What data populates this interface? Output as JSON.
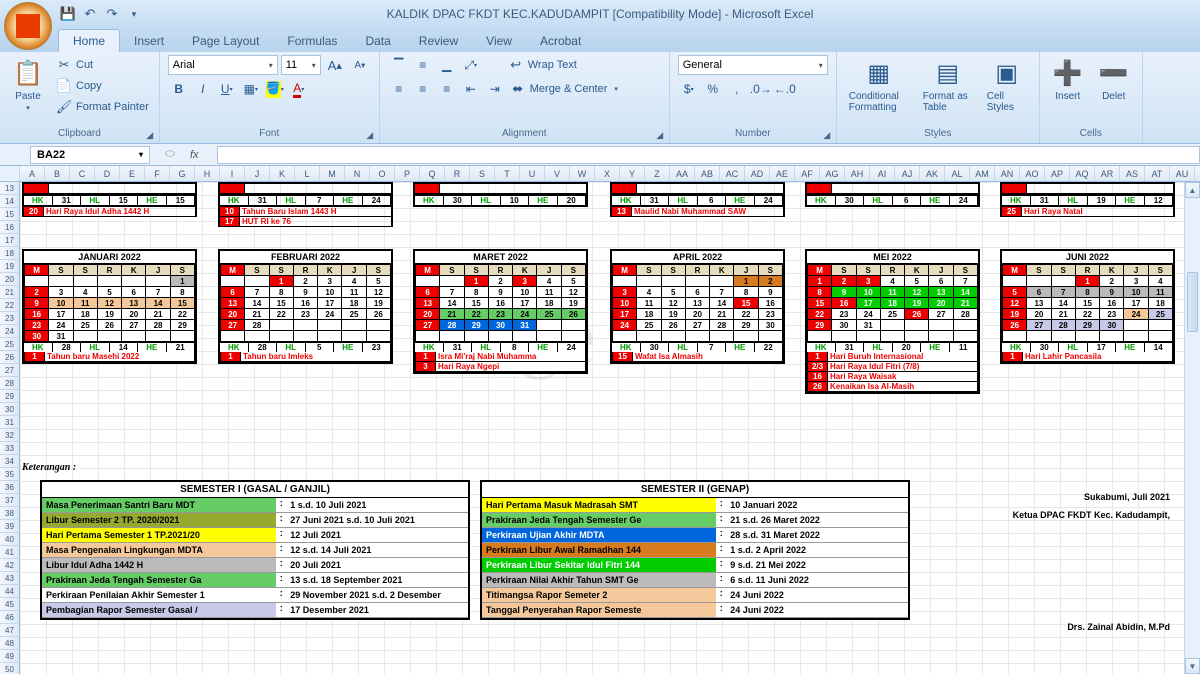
{
  "title": "KALDIK DPAC FKDT KEC.KADUDAMPIT  [Compatibility Mode] - Microsoft Excel",
  "namebox": "BA22",
  "tabs": [
    "Home",
    "Insert",
    "Page Layout",
    "Formulas",
    "Data",
    "Review",
    "View",
    "Acrobat"
  ],
  "clipboard": {
    "paste": "Paste",
    "cut": "Cut",
    "copy": "Copy",
    "fp": "Format Painter",
    "label": "Clipboard"
  },
  "font": {
    "name": "Arial",
    "size": "11",
    "label": "Font"
  },
  "alignment": {
    "wrap": "Wrap Text",
    "merge": "Merge & Center",
    "label": "Alignment"
  },
  "number": {
    "fmt": "General",
    "label": "Number"
  },
  "styles": {
    "cf": "Conditional Formatting",
    "ft": "Format as Table",
    "cs": "Cell Styles",
    "label": "Styles"
  },
  "cells": {
    "insert": "Insert",
    "delete": "Delet",
    "label": "Cells"
  },
  "cols": [
    "A",
    "B",
    "C",
    "D",
    "E",
    "F",
    "G",
    "H",
    "I",
    "J",
    "K",
    "L",
    "M",
    "N",
    "O",
    "P",
    "Q",
    "R",
    "S",
    "T",
    "U",
    "V",
    "W",
    "X",
    "Y",
    "Z",
    "AA",
    "AB",
    "AC",
    "AD",
    "AE",
    "AF",
    "AG",
    "AH",
    "AI",
    "AJ",
    "AK",
    "AL",
    "AM",
    "AN",
    "AO",
    "AP",
    "AQ",
    "AR",
    "AS",
    "AT",
    "AU"
  ],
  "rows_start": 13,
  "watermark": "Page 1",
  "ket": "Keterangan :",
  "hk_top": [
    [
      "HK",
      "31",
      "HL",
      "15",
      "HE",
      "15"
    ],
    [
      "HK",
      "31",
      "HL",
      "7",
      "HE",
      "24"
    ],
    [
      "HK",
      "30",
      "HL",
      "10",
      "HE",
      "20"
    ],
    [
      "HK",
      "31",
      "HL",
      "6",
      "HE",
      "24"
    ],
    [
      "HK",
      "30",
      "HL",
      "6",
      "HE",
      "24"
    ],
    [
      "HK",
      "31",
      "HL",
      "19",
      "HE",
      "12"
    ]
  ],
  "ev_top": [
    [
      {
        "d": "20",
        "t": "Hari Raya Idul Adha 1442 H"
      }
    ],
    [
      {
        "d": "10",
        "t": "Tahun Baru Islam 1443 H"
      },
      {
        "d": "17",
        "t": "HUT RI ke 76"
      }
    ],
    [],
    [
      {
        "d": "13",
        "t": "Maulid Nabi Muhammad SAW"
      }
    ],
    [],
    [
      {
        "d": "25",
        "t": "Hari Raya Natal"
      }
    ]
  ],
  "cals": [
    {
      "title": "JANUARI 2022",
      "hk": [
        "HK",
        "28",
        "HL",
        "14",
        "HE",
        "21"
      ],
      "ev": [
        {
          "d": "1",
          "t": "Tahun baru Masehi 2022"
        }
      ],
      "grid": [
        [
          "",
          "",
          "",
          "",
          "",
          "",
          "1"
        ],
        [
          "2",
          "3",
          "4",
          "5",
          "6",
          "7",
          "8"
        ],
        [
          "9",
          "10",
          "11",
          "12",
          "13",
          "14",
          "15"
        ],
        [
          "16",
          "17",
          "18",
          "19",
          "20",
          "21",
          "22"
        ],
        [
          "23",
          "24",
          "25",
          "26",
          "27",
          "28",
          "29"
        ],
        [
          "30",
          "31",
          "",
          "",
          "",
          "",
          ""
        ]
      ],
      "cls": [
        [
          "",
          "",
          "",
          "",
          "",
          "",
          "gray"
        ],
        [
          "red",
          "",
          "",
          "",
          "",
          "",
          ""
        ],
        [
          "red",
          "peach",
          "peach",
          "peach",
          "peach",
          "peach",
          "peach"
        ],
        [
          "red",
          "",
          "",
          "",
          "",
          "",
          ""
        ],
        [
          "red",
          "",
          "",
          "",
          "",
          "",
          ""
        ],
        [
          "red",
          "",
          "",
          "",
          "",
          "",
          ""
        ]
      ]
    },
    {
      "title": "FEBRUARI 2022",
      "hk": [
        "HK",
        "28",
        "HL",
        "5",
        "HE",
        "23"
      ],
      "ev": [
        {
          "d": "1",
          "t": "Tahun baru Imleks"
        }
      ],
      "grid": [
        [
          "",
          "",
          "1",
          "2",
          "3",
          "4",
          "5"
        ],
        [
          "6",
          "7",
          "8",
          "9",
          "10",
          "11",
          "12"
        ],
        [
          "13",
          "14",
          "15",
          "16",
          "17",
          "18",
          "19"
        ],
        [
          "20",
          "21",
          "22",
          "23",
          "24",
          "25",
          "26"
        ],
        [
          "27",
          "28",
          "",
          "",
          "",
          "",
          ""
        ],
        [
          "",
          "",
          "",
          "",
          "",
          "",
          ""
        ]
      ],
      "cls": [
        [
          "",
          "",
          "red",
          "",
          "",
          "",
          ""
        ],
        [
          "red",
          "",
          "",
          "",
          "",
          "",
          ""
        ],
        [
          "red",
          "",
          "",
          "",
          "",
          "",
          ""
        ],
        [
          "red",
          "",
          "",
          "",
          "",
          "",
          ""
        ],
        [
          "red",
          "",
          "",
          "",
          "",
          "",
          ""
        ],
        [
          "",
          "",
          "",
          "",
          "",
          "",
          ""
        ]
      ]
    },
    {
      "title": "MARET 2022",
      "hk": [
        "HK",
        "31",
        "HL",
        "8",
        "HE",
        "24"
      ],
      "ev": [
        {
          "d": "1",
          "t": "Isra Mi'raj Nabi Muhamma"
        },
        {
          "d": "3",
          "t": "Hari Raya Ngepi"
        }
      ],
      "grid": [
        [
          "",
          "",
          "1",
          "2",
          "3",
          "4",
          "5"
        ],
        [
          "6",
          "7",
          "8",
          "9",
          "10",
          "11",
          "12"
        ],
        [
          "13",
          "14",
          "15",
          "16",
          "17",
          "18",
          "19"
        ],
        [
          "20",
          "21",
          "22",
          "23",
          "24",
          "25",
          "26"
        ],
        [
          "27",
          "28",
          "29",
          "30",
          "31",
          "",
          ""
        ],
        [
          "",
          "",
          "",
          "",
          "",
          "",
          ""
        ]
      ],
      "cls": [
        [
          "",
          "",
          "red",
          "",
          "red",
          "",
          ""
        ],
        [
          "red",
          "",
          "",
          "",
          "",
          "",
          ""
        ],
        [
          "red",
          "",
          "",
          "",
          "",
          "",
          ""
        ],
        [
          "red",
          "lgreen",
          "lgreen",
          "lgreen",
          "lgreen",
          "lgreen",
          "lgreen"
        ],
        [
          "red",
          "blue",
          "blue",
          "blue",
          "blue",
          "",
          ""
        ],
        [
          "",
          "",
          "",
          "",
          "",
          "",
          ""
        ]
      ]
    },
    {
      "title": "APRIL 2022",
      "hk": [
        "HK",
        "30",
        "HL",
        "7",
        "HE",
        "22"
      ],
      "ev": [
        {
          "d": "15",
          "t": "Wafat Isa Almasih"
        }
      ],
      "grid": [
        [
          "",
          "",
          "",
          "",
          "",
          "1",
          "2"
        ],
        [
          "3",
          "4",
          "5",
          "6",
          "7",
          "8",
          "9"
        ],
        [
          "10",
          "11",
          "12",
          "13",
          "14",
          "15",
          "16"
        ],
        [
          "17",
          "18",
          "19",
          "20",
          "21",
          "22",
          "23"
        ],
        [
          "24",
          "25",
          "26",
          "27",
          "28",
          "29",
          "30"
        ],
        [
          "",
          "",
          "",
          "",
          "",
          "",
          ""
        ]
      ],
      "cls": [
        [
          "",
          "",
          "",
          "",
          "",
          "orange",
          "orange"
        ],
        [
          "red",
          "",
          "",
          "",
          "",
          "",
          ""
        ],
        [
          "red",
          "",
          "",
          "",
          "",
          "red",
          ""
        ],
        [
          "red",
          "",
          "",
          "",
          "",
          "",
          ""
        ],
        [
          "red",
          "",
          "",
          "",
          "",
          "",
          ""
        ],
        [
          "",
          "",
          "",
          "",
          "",
          "",
          ""
        ]
      ]
    },
    {
      "title": "MEI 2022",
      "hk": [
        "HK",
        "31",
        "HL",
        "20",
        "HE",
        "11"
      ],
      "ev": [
        {
          "d": "1",
          "t": "Hari Buruh Internasional"
        },
        {
          "d": "2/3",
          "t": "Hari Raya Idul Fitri (7/8)"
        },
        {
          "d": "16",
          "t": "Hari Raya Waisak"
        },
        {
          "d": "26",
          "t": "Kenaikan Isa Al-Masih"
        }
      ],
      "grid": [
        [
          "1",
          "2",
          "3",
          "4",
          "5",
          "6",
          "7"
        ],
        [
          "8",
          "9",
          "10",
          "11",
          "12",
          "13",
          "14"
        ],
        [
          "15",
          "16",
          "17",
          "18",
          "19",
          "20",
          "21"
        ],
        [
          "22",
          "23",
          "24",
          "25",
          "26",
          "27",
          "28"
        ],
        [
          "29",
          "30",
          "31",
          "",
          "",
          "",
          ""
        ],
        [
          "",
          "",
          "",
          "",
          "",
          "",
          ""
        ]
      ],
      "cls": [
        [
          "red",
          "red",
          "red",
          "",
          "",
          "",
          ""
        ],
        [
          "red",
          "green",
          "green",
          "green",
          "green",
          "green",
          "green"
        ],
        [
          "red",
          "red",
          "green",
          "green",
          "green",
          "green",
          "green"
        ],
        [
          "red",
          "",
          "",
          "",
          "red",
          "",
          ""
        ],
        [
          "red",
          "",
          "",
          "",
          "",
          "",
          ""
        ],
        [
          "",
          "",
          "",
          "",
          "",
          "",
          ""
        ]
      ]
    },
    {
      "title": "JUNI 2022",
      "hk": [
        "HK",
        "30",
        "HL",
        "17",
        "HE",
        "14"
      ],
      "ev": [
        {
          "d": "1",
          "t": "Hari Lahir Pancasila"
        }
      ],
      "grid": [
        [
          "",
          "",
          "",
          "1",
          "2",
          "3",
          "4"
        ],
        [
          "5",
          "6",
          "7",
          "8",
          "9",
          "10",
          "11"
        ],
        [
          "12",
          "13",
          "14",
          "15",
          "16",
          "17",
          "18"
        ],
        [
          "19",
          "20",
          "21",
          "22",
          "23",
          "24",
          "25"
        ],
        [
          "26",
          "27",
          "28",
          "29",
          "30",
          "",
          ""
        ],
        [
          "",
          "",
          "",
          "",
          "",
          "",
          ""
        ]
      ],
      "cls": [
        [
          "",
          "",
          "",
          "red",
          "",
          "",
          ""
        ],
        [
          "red",
          "gray",
          "gray",
          "gray",
          "gray",
          "gray",
          "gray"
        ],
        [
          "red",
          "",
          "",
          "",
          "",
          "",
          ""
        ],
        [
          "red",
          "",
          "",
          "",
          "",
          "peach",
          "lavender"
        ],
        [
          "red",
          "lavender",
          "lavender",
          "lavender",
          "lavender",
          "",
          ""
        ],
        [
          "",
          "",
          "",
          "",
          "",
          "",
          ""
        ]
      ]
    }
  ],
  "sem1": {
    "title": "SEMESTER I (GASAL / GANJIL)",
    "rows": [
      {
        "c": "lgreen",
        "l": "Masa Penerimaan Santri Baru MDT",
        "v": "1 s.d. 10 Juli 2021"
      },
      {
        "c": "olive",
        "l": "Libur Semester 2 TP. 2020/2021",
        "v": "27 Juni 2021 s.d. 10 Juli 2021"
      },
      {
        "c": "yellow",
        "l": "Hari Pertama Semester 1 TP.2021/20",
        "v": "12 Juli 2021"
      },
      {
        "c": "peach",
        "l": "Masa Pengenalan Lingkungan MDTA",
        "v": "12 s.d. 14 Juli 2021"
      },
      {
        "c": "gray",
        "l": "Libur Idul Adha 1442 H",
        "v": "20 Juli 2021"
      },
      {
        "c": "lgreen",
        "l": "Prakiraan Jeda Tengah Semester Ga",
        "v": "13 s.d. 18 September 2021"
      },
      {
        "c": "",
        "l": "Perkiraan Penilaian Akhir Semester 1",
        "v": "29 November 2021 s.d. 2 Desember"
      },
      {
        "c": "lavender",
        "l": "Pembagian Rapor Semester Gasal /",
        "v": "17 Desember 2021"
      }
    ]
  },
  "sem2": {
    "title": "SEMESTER II (GENAP)",
    "rows": [
      {
        "c": "yellow",
        "l": "Hari Pertama Masuk Madrasah SMT",
        "v": "10 Januari 2022"
      },
      {
        "c": "lgreen",
        "l": "Prakiraan Jeda Tengah Semester Ge",
        "v": "21 s.d. 26 Maret 2022"
      },
      {
        "c": "blue",
        "l": "Perkiraan Ujian Akhir MDTA",
        "v": "28 s.d. 31  Maret 2022"
      },
      {
        "c": "orange",
        "l": "Perkiraan Libur Awal Ramadhan 144",
        "v": "1 s.d. 2  April 2022"
      },
      {
        "c": "green",
        "l": "Perkiraan Libur Sekitar Idul Fitri 144",
        "v": "9 s.d. 21 Mei 2022"
      },
      {
        "c": "gray",
        "l": "Perkiraan Nilai Akhir Tahun SMT Ge",
        "v": "6 s.d. 11 Juni 2022"
      },
      {
        "c": "peach",
        "l": "Titimangsa Rapor Semeter 2",
        "v": "24 Juni 2022"
      },
      {
        "c": "peach",
        "l": "Tanggal Penyerahan Rapor Semeste",
        "v": "24 Juni 2022"
      }
    ]
  },
  "sig1": "Sukabumi,  Juli 2021",
  "sig2": "Ketua DPAC FKDT Kec. Kadudampit,",
  "sig3": "Drs. Zainal Abidin, M.Pd"
}
